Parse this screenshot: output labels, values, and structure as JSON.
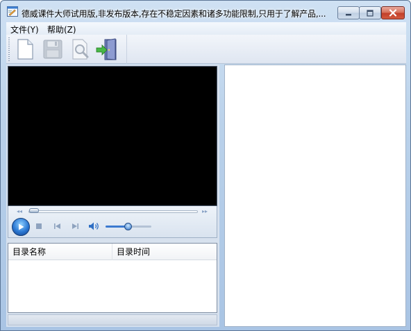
{
  "window": {
    "title": "德威课件大师试用版,非发布版本,存在不稳定因素和诸多功能限制,只用于了解产品,..."
  },
  "menu": {
    "items": [
      {
        "label": "文件(Y)"
      },
      {
        "label": "帮助(Z)"
      }
    ]
  },
  "toolbar": {
    "buttons": [
      {
        "icon": "new-document-icon"
      },
      {
        "icon": "save-icon"
      },
      {
        "icon": "preview-icon"
      },
      {
        "icon": "exit-door-icon"
      }
    ]
  },
  "player": {
    "state": "stopped",
    "seek_position": 0,
    "volume": 0.5
  },
  "catalog": {
    "columns": [
      "目录名称",
      "目录时间"
    ],
    "rows": []
  },
  "colors": {
    "accent": "#2b78d3",
    "video_background": "#000000",
    "close_button": "#c2402a"
  }
}
